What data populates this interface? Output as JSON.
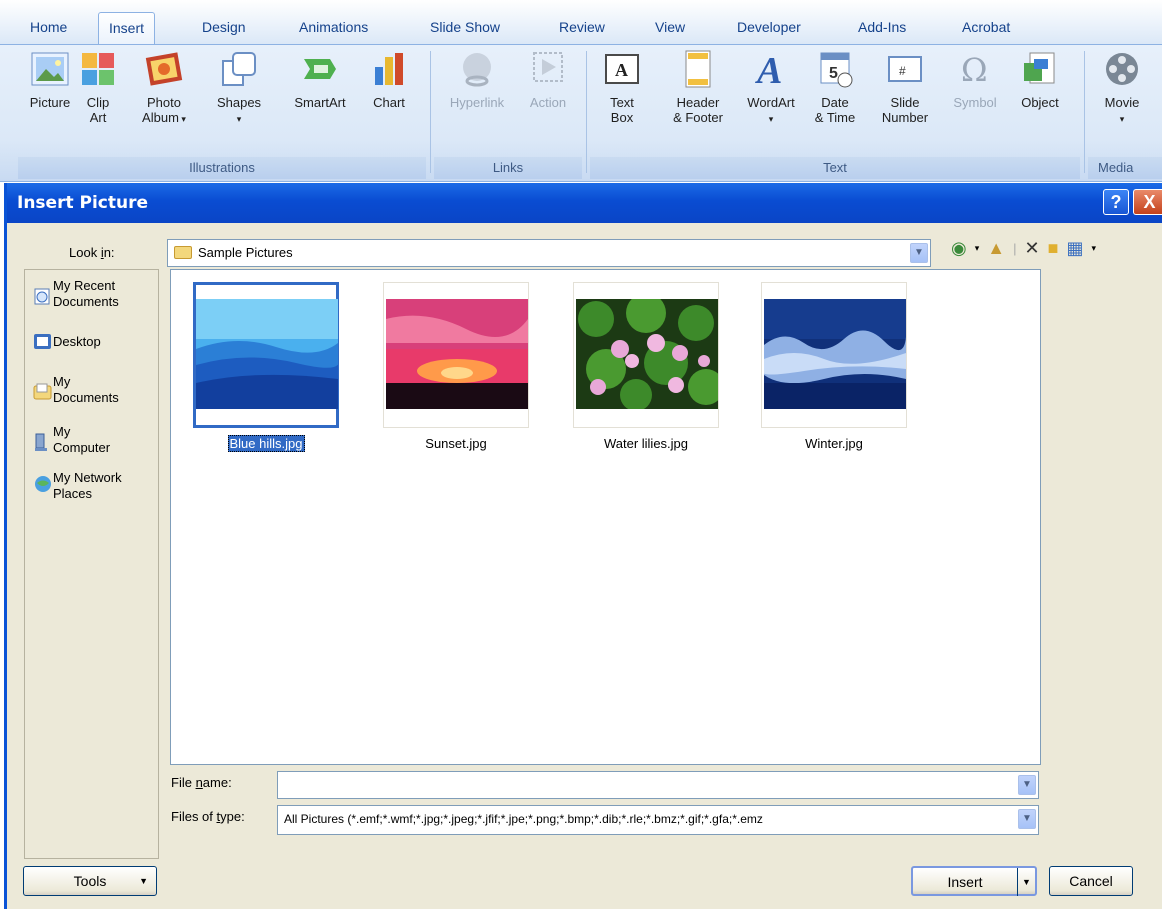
{
  "ribbon": {
    "tabs": [
      "Home",
      "Insert",
      "Design",
      "Animations",
      "Slide Show",
      "Review",
      "View",
      "Developer",
      "Add-Ins",
      "Acrobat"
    ],
    "active_tab": "Insert",
    "groups": {
      "illustrations": "Illustrations",
      "links": "Links",
      "text": "Text",
      "media": "Media"
    },
    "buttons": {
      "picture": "Picture",
      "clip_art": "Clip\nArt",
      "photo_album": "Photo\nAlbum",
      "shapes": "Shapes",
      "smartart": "SmartArt",
      "chart": "Chart",
      "hyperlink": "Hyperlink",
      "action": "Action",
      "text_box": "Text\nBox",
      "header_footer": "Header\n& Footer",
      "wordart": "WordArt",
      "date_time": "Date\n& Time",
      "slide_number": "Slide\nNumber",
      "symbol": "Symbol",
      "object": "Object",
      "movie": "Movie"
    }
  },
  "dialog": {
    "title": "Insert Picture",
    "help": "?",
    "close": "X",
    "look_in_label": "Look in:",
    "look_in_value": "Sample Pictures",
    "places": [
      {
        "label": "My Recent\nDocuments",
        "icon": "recent-documents-icon"
      },
      {
        "label": "Desktop",
        "icon": "desktop-icon"
      },
      {
        "label": "My\nDocuments",
        "icon": "my-documents-icon"
      },
      {
        "label": "My\nComputer",
        "icon": "my-computer-icon"
      },
      {
        "label": "My Network\nPlaces",
        "icon": "network-places-icon"
      }
    ],
    "files": [
      {
        "name": "Blue hills.jpg",
        "selected": true
      },
      {
        "name": "Sunset.jpg",
        "selected": false
      },
      {
        "name": "Water lilies.jpg",
        "selected": false
      },
      {
        "name": "Winter.jpg",
        "selected": false
      }
    ],
    "file_name_label": "File name:",
    "file_name_value": "",
    "files_of_type_label": "Files of type:",
    "files_of_type_value": "All Pictures (*.emf;*.wmf;*.jpg;*.jpeg;*.jfif;*.jpe;*.png;*.bmp;*.dib;*.rle;*.bmz;*.gif;*.gfa;*.emz",
    "tools_label": "Tools",
    "insert_label": "Insert",
    "cancel_label": "Cancel"
  },
  "colors": {
    "titlebar": "#0a4cd2",
    "selection": "#316ac5",
    "dialog_bg": "#ece9d8",
    "ribbon_bg": "#dbe8f7"
  }
}
